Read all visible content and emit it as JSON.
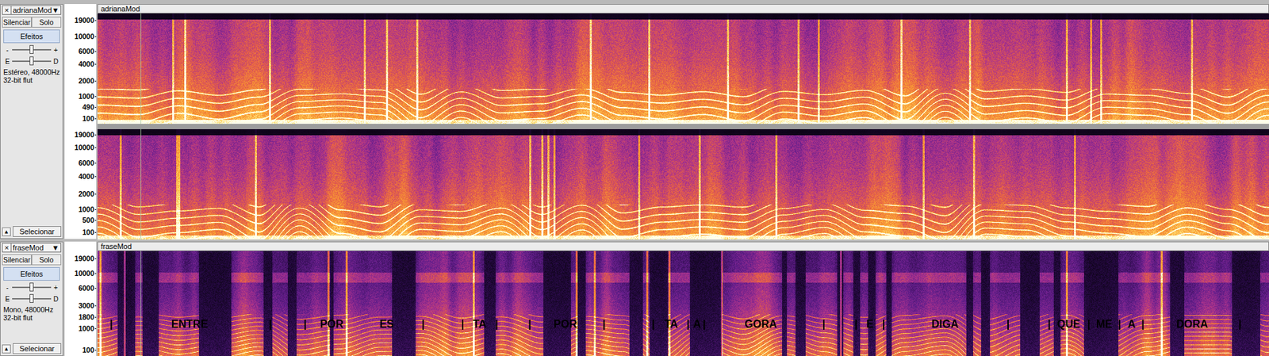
{
  "tracks": [
    {
      "name": "adrianaMod",
      "close": "×",
      "menu": "▼",
      "mute": "Silenciar",
      "muted": false,
      "solo": "Solo",
      "soloed": false,
      "effects": "Efeitos",
      "gain": {
        "minus": "-",
        "plus": "+",
        "level": 0.5
      },
      "pan": {
        "left": "E",
        "right": "D",
        "level": 0.5
      },
      "info": [
        "Estéreo, 48000Hz",
        "32-bit flut"
      ],
      "collapse": "▲",
      "select": "Selecionar",
      "title": "adrianaMod",
      "channels": [
        {
          "axis": [
            "19000",
            "10000",
            "6000",
            "4000",
            "2000",
            "1000",
            "490",
            "100"
          ]
        },
        {
          "axis": [
            "19000",
            "10000",
            "6000",
            "4000",
            "2000",
            "1000",
            "500",
            "100"
          ]
        }
      ],
      "labels": []
    },
    {
      "name": "fraseMod",
      "close": "×",
      "menu": "▼",
      "mute": "Silenciar",
      "muted": false,
      "solo": "Solo",
      "soloed": false,
      "effects": "Efeitos",
      "gain": {
        "minus": "-",
        "plus": "+",
        "level": 0.5
      },
      "pan": {
        "left": "E",
        "right": "D",
        "level": 0.5
      },
      "info": [
        "Mono, 48000Hz",
        "32-bit flut"
      ],
      "collapse": "▲",
      "select": "Selecionar",
      "title": "fraseMod",
      "channels": [
        {
          "axis": [
            "19000",
            "10000",
            "6000",
            "3000",
            "1800",
            "1000",
            "100"
          ]
        }
      ],
      "labels": [
        {
          "text": "|"
        },
        {
          "text": "ENTRE"
        },
        {
          "text": "|"
        },
        {
          "text": "|"
        },
        {
          "text": "POR"
        },
        {
          "text": "ES"
        },
        {
          "text": "|"
        },
        {
          "text": "|"
        },
        {
          "text": "TA"
        },
        {
          "text": "|"
        },
        {
          "text": "|"
        },
        {
          "text": "POR"
        },
        {
          "text": "|"
        },
        {
          "text": "|"
        },
        {
          "text": "TA"
        },
        {
          "text": "|"
        },
        {
          "text": "A"
        },
        {
          "text": "|"
        },
        {
          "text": "GORA"
        },
        {
          "text": "|"
        },
        {
          "text": "|"
        },
        {
          "text": "E"
        },
        {
          "text": "|"
        },
        {
          "text": "DIGA"
        },
        {
          "text": "|"
        },
        {
          "text": "|"
        },
        {
          "text": "QUE"
        },
        {
          "text": "|"
        },
        {
          "text": "ME"
        },
        {
          "text": "|"
        },
        {
          "text": "A"
        },
        {
          "text": "|"
        },
        {
          "text": "DORA"
        },
        {
          "text": "|"
        }
      ]
    }
  ]
}
